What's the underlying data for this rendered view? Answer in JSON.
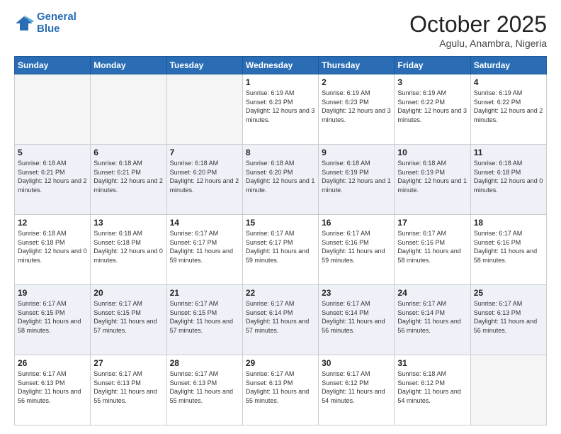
{
  "logo": {
    "line1": "General",
    "line2": "Blue"
  },
  "header": {
    "month": "October 2025",
    "location": "Agulu, Anambra, Nigeria"
  },
  "weekdays": [
    "Sunday",
    "Monday",
    "Tuesday",
    "Wednesday",
    "Thursday",
    "Friday",
    "Saturday"
  ],
  "weeks": [
    [
      {
        "day": "",
        "info": ""
      },
      {
        "day": "",
        "info": ""
      },
      {
        "day": "",
        "info": ""
      },
      {
        "day": "1",
        "info": "Sunrise: 6:19 AM\nSunset: 6:23 PM\nDaylight: 12 hours\nand 3 minutes."
      },
      {
        "day": "2",
        "info": "Sunrise: 6:19 AM\nSunset: 6:23 PM\nDaylight: 12 hours\nand 3 minutes."
      },
      {
        "day": "3",
        "info": "Sunrise: 6:19 AM\nSunset: 6:22 PM\nDaylight: 12 hours\nand 3 minutes."
      },
      {
        "day": "4",
        "info": "Sunrise: 6:19 AM\nSunset: 6:22 PM\nDaylight: 12 hours\nand 2 minutes."
      }
    ],
    [
      {
        "day": "5",
        "info": "Sunrise: 6:18 AM\nSunset: 6:21 PM\nDaylight: 12 hours\nand 2 minutes."
      },
      {
        "day": "6",
        "info": "Sunrise: 6:18 AM\nSunset: 6:21 PM\nDaylight: 12 hours\nand 2 minutes."
      },
      {
        "day": "7",
        "info": "Sunrise: 6:18 AM\nSunset: 6:20 PM\nDaylight: 12 hours\nand 2 minutes."
      },
      {
        "day": "8",
        "info": "Sunrise: 6:18 AM\nSunset: 6:20 PM\nDaylight: 12 hours\nand 1 minute."
      },
      {
        "day": "9",
        "info": "Sunrise: 6:18 AM\nSunset: 6:19 PM\nDaylight: 12 hours\nand 1 minute."
      },
      {
        "day": "10",
        "info": "Sunrise: 6:18 AM\nSunset: 6:19 PM\nDaylight: 12 hours\nand 1 minute."
      },
      {
        "day": "11",
        "info": "Sunrise: 6:18 AM\nSunset: 6:18 PM\nDaylight: 12 hours\nand 0 minutes."
      }
    ],
    [
      {
        "day": "12",
        "info": "Sunrise: 6:18 AM\nSunset: 6:18 PM\nDaylight: 12 hours\nand 0 minutes."
      },
      {
        "day": "13",
        "info": "Sunrise: 6:18 AM\nSunset: 6:18 PM\nDaylight: 12 hours\nand 0 minutes."
      },
      {
        "day": "14",
        "info": "Sunrise: 6:17 AM\nSunset: 6:17 PM\nDaylight: 11 hours\nand 59 minutes."
      },
      {
        "day": "15",
        "info": "Sunrise: 6:17 AM\nSunset: 6:17 PM\nDaylight: 11 hours\nand 59 minutes."
      },
      {
        "day": "16",
        "info": "Sunrise: 6:17 AM\nSunset: 6:16 PM\nDaylight: 11 hours\nand 59 minutes."
      },
      {
        "day": "17",
        "info": "Sunrise: 6:17 AM\nSunset: 6:16 PM\nDaylight: 11 hours\nand 58 minutes."
      },
      {
        "day": "18",
        "info": "Sunrise: 6:17 AM\nSunset: 6:16 PM\nDaylight: 11 hours\nand 58 minutes."
      }
    ],
    [
      {
        "day": "19",
        "info": "Sunrise: 6:17 AM\nSunset: 6:15 PM\nDaylight: 11 hours\nand 58 minutes."
      },
      {
        "day": "20",
        "info": "Sunrise: 6:17 AM\nSunset: 6:15 PM\nDaylight: 11 hours\nand 57 minutes."
      },
      {
        "day": "21",
        "info": "Sunrise: 6:17 AM\nSunset: 6:15 PM\nDaylight: 11 hours\nand 57 minutes."
      },
      {
        "day": "22",
        "info": "Sunrise: 6:17 AM\nSunset: 6:14 PM\nDaylight: 11 hours\nand 57 minutes."
      },
      {
        "day": "23",
        "info": "Sunrise: 6:17 AM\nSunset: 6:14 PM\nDaylight: 11 hours\nand 56 minutes."
      },
      {
        "day": "24",
        "info": "Sunrise: 6:17 AM\nSunset: 6:14 PM\nDaylight: 11 hours\nand 56 minutes."
      },
      {
        "day": "25",
        "info": "Sunrise: 6:17 AM\nSunset: 6:13 PM\nDaylight: 11 hours\nand 56 minutes."
      }
    ],
    [
      {
        "day": "26",
        "info": "Sunrise: 6:17 AM\nSunset: 6:13 PM\nDaylight: 11 hours\nand 56 minutes."
      },
      {
        "day": "27",
        "info": "Sunrise: 6:17 AM\nSunset: 6:13 PM\nDaylight: 11 hours\nand 55 minutes."
      },
      {
        "day": "28",
        "info": "Sunrise: 6:17 AM\nSunset: 6:13 PM\nDaylight: 11 hours\nand 55 minutes."
      },
      {
        "day": "29",
        "info": "Sunrise: 6:17 AM\nSunset: 6:13 PM\nDaylight: 11 hours\nand 55 minutes."
      },
      {
        "day": "30",
        "info": "Sunrise: 6:17 AM\nSunset: 6:12 PM\nDaylight: 11 hours\nand 54 minutes."
      },
      {
        "day": "31",
        "info": "Sunrise: 6:18 AM\nSunset: 6:12 PM\nDaylight: 11 hours\nand 54 minutes."
      },
      {
        "day": "",
        "info": ""
      }
    ]
  ]
}
